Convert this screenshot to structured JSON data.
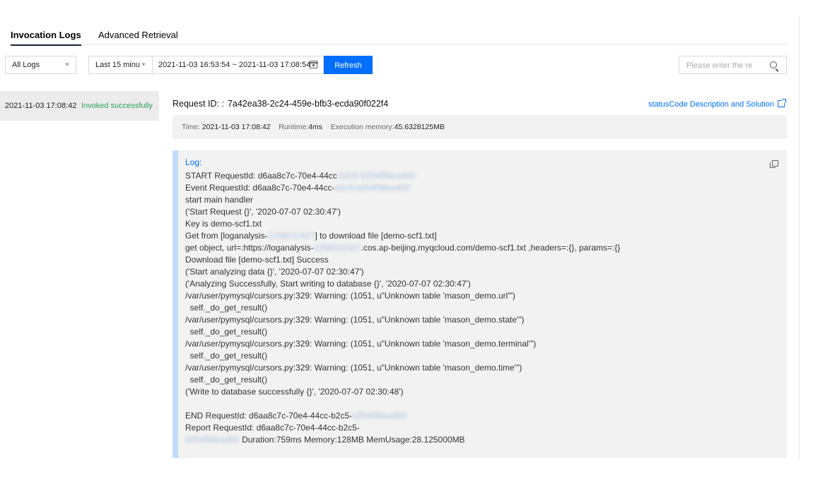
{
  "tabs": {
    "active": "Invocation Logs",
    "inactive": "Advanced Retrieval"
  },
  "toolbar": {
    "log_type": "All Logs",
    "time_preset": "Last 15 minu",
    "time_range": "2021-11-03 16:53:54 ~ 2021-11-03 17:08:54",
    "refresh": "Refresh",
    "search_placeholder": "Please enter the re"
  },
  "left_list": {
    "time": "2021-11-03 17:08:42",
    "status": "Invoked successfully"
  },
  "request": {
    "label": "Request ID: :",
    "id": "7a42ea38-2c24-459e-bfb3-ecda90f022f4",
    "status_link": "statusCode Description and Solution"
  },
  "meta": {
    "time_label": "Time:",
    "time_value": "2021-11-03 17:08:42",
    "runtime_label": "Runtime:",
    "runtime_value": "4ms",
    "memory_label": "Execution memory:",
    "memory_value": "45.6328125MB"
  },
  "log": {
    "title": "Log:",
    "lines": [
      [
        "START RequestId: d6aa8c7c-70e4-44cc",
        "-b2c5-b204f98ea400",
        ""
      ],
      [
        "Event RequestId: d6aa8c7c-70e4-44cc-",
        "b2c5-b204f98ea400",
        ""
      ],
      [
        "start main handler",
        "",
        ""
      ],
      [
        "('Start Request {}', '2020-07-07 02:30:47')",
        "",
        ""
      ],
      [
        "Key is demo-scf1.txt",
        "",
        ""
      ],
      [
        "Get from [loganalysis-",
        "1258222427",
        "] to download file [demo-scf1.txt]"
      ],
      [
        "get object, url=:https://loganalysis-",
        "1258222427",
        ".cos.ap-beijing.myqcloud.com/demo-scf1.txt ,headers=:{}, params=:{}"
      ],
      [
        "Download file [demo-scf1.txt] Success",
        "",
        ""
      ],
      [
        "('Start analyzing data {}', '2020-07-07 02:30:47')",
        "",
        ""
      ],
      [
        "('Analyzing Successfully, Start writing to database {}', '2020-07-07 02:30:47')",
        "",
        ""
      ],
      [
        "/var/user/pymysql/cursors.py:329: Warning: (1051, u\"Unknown table 'mason_demo.url'\")",
        "",
        ""
      ],
      [
        "  self._do_get_result()",
        "",
        ""
      ],
      [
        "/var/user/pymysql/cursors.py:329: Warning: (1051, u\"Unknown table 'mason_demo.state'\")",
        "",
        ""
      ],
      [
        "  self._do_get_result()",
        "",
        ""
      ],
      [
        "/var/user/pymysql/cursors.py:329: Warning: (1051, u\"Unknown table 'mason_demo.terminal'\")",
        "",
        ""
      ],
      [
        "  self._do_get_result()",
        "",
        ""
      ],
      [
        "/var/user/pymysql/cursors.py:329: Warning: (1051, u\"Unknown table 'mason_demo.time'\")",
        "",
        ""
      ],
      [
        "  self._do_get_result()",
        "",
        ""
      ],
      [
        "('Write to database successfully {}', '2020-07-07 02:30:48')",
        "",
        ""
      ],
      [
        "",
        "",
        ""
      ],
      [
        "END RequestId: d6aa8c7c-70e4-44cc-b2c5-",
        "b204f98ea400",
        ""
      ],
      [
        "Report RequestId: d6aa8c7c-70e4-44cc-b2c5-",
        "",
        ""
      ],
      [
        "",
        "b204f98ea400",
        " Duration:759ms Memory:128MB MemUsage:28.125000MB"
      ]
    ]
  }
}
